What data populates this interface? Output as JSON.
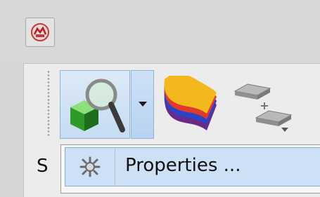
{
  "window": {
    "icon": "app-tool-icon"
  },
  "toolbar": {
    "items": [
      {
        "icon": "inspect-magnifier-icon"
      },
      {
        "icon": "dropdown-arrow-icon"
      },
      {
        "icon": "layered-surface-icon"
      },
      {
        "icon": "stacked-layers-icon"
      }
    ]
  },
  "side_panel": {
    "label": "S"
  },
  "context_menu": {
    "items": [
      {
        "icon": "properties-gear-icon",
        "label": "Properties ..."
      }
    ]
  },
  "colors": {
    "selection": "#cde0f6",
    "selection_border": "#86acd6",
    "button_hover": "#c6dbf2"
  }
}
